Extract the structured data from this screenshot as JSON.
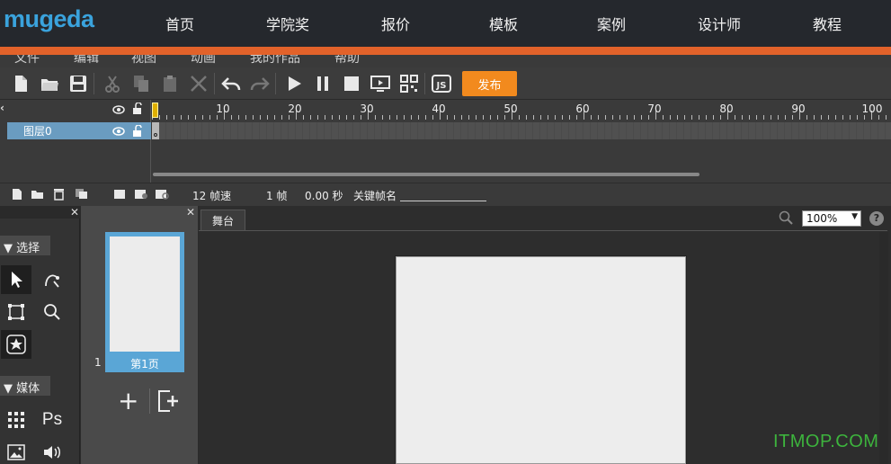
{
  "logo": "mugeda",
  "nav": [
    "首页",
    "学院奖",
    "报价",
    "模板",
    "案例",
    "设计师",
    "教程"
  ],
  "menu": [
    "文件",
    "编辑",
    "视图",
    "动画",
    "我的作品",
    "帮助"
  ],
  "toolbar": {
    "publish_label": "发布"
  },
  "timeline": {
    "ruler_numbers": [
      "10",
      "20",
      "30",
      "40",
      "50",
      "60",
      "70",
      "80",
      "90",
      "100"
    ],
    "layer_name": "图层0",
    "fps_label": "12 帧速",
    "frame_label": "1 帧",
    "time_label": "0.00 秒",
    "keyframe_label": "关键帧名"
  },
  "tools": {
    "select_section": "选择",
    "media_section": "媒体",
    "ps_label": "Ps"
  },
  "pages": {
    "number": "1",
    "page_label": "第1页",
    "add_label": "+"
  },
  "stage": {
    "tab_label": "舞台",
    "zoom_value": "100%",
    "help_label": "?"
  },
  "watermark": "ITMOP.COM",
  "colors": {
    "accent_orange": "#e2622a",
    "publish_orange": "#f28a1e",
    "logo_blue": "#3aa3dd",
    "selection_blue": "#5aa6d6"
  }
}
